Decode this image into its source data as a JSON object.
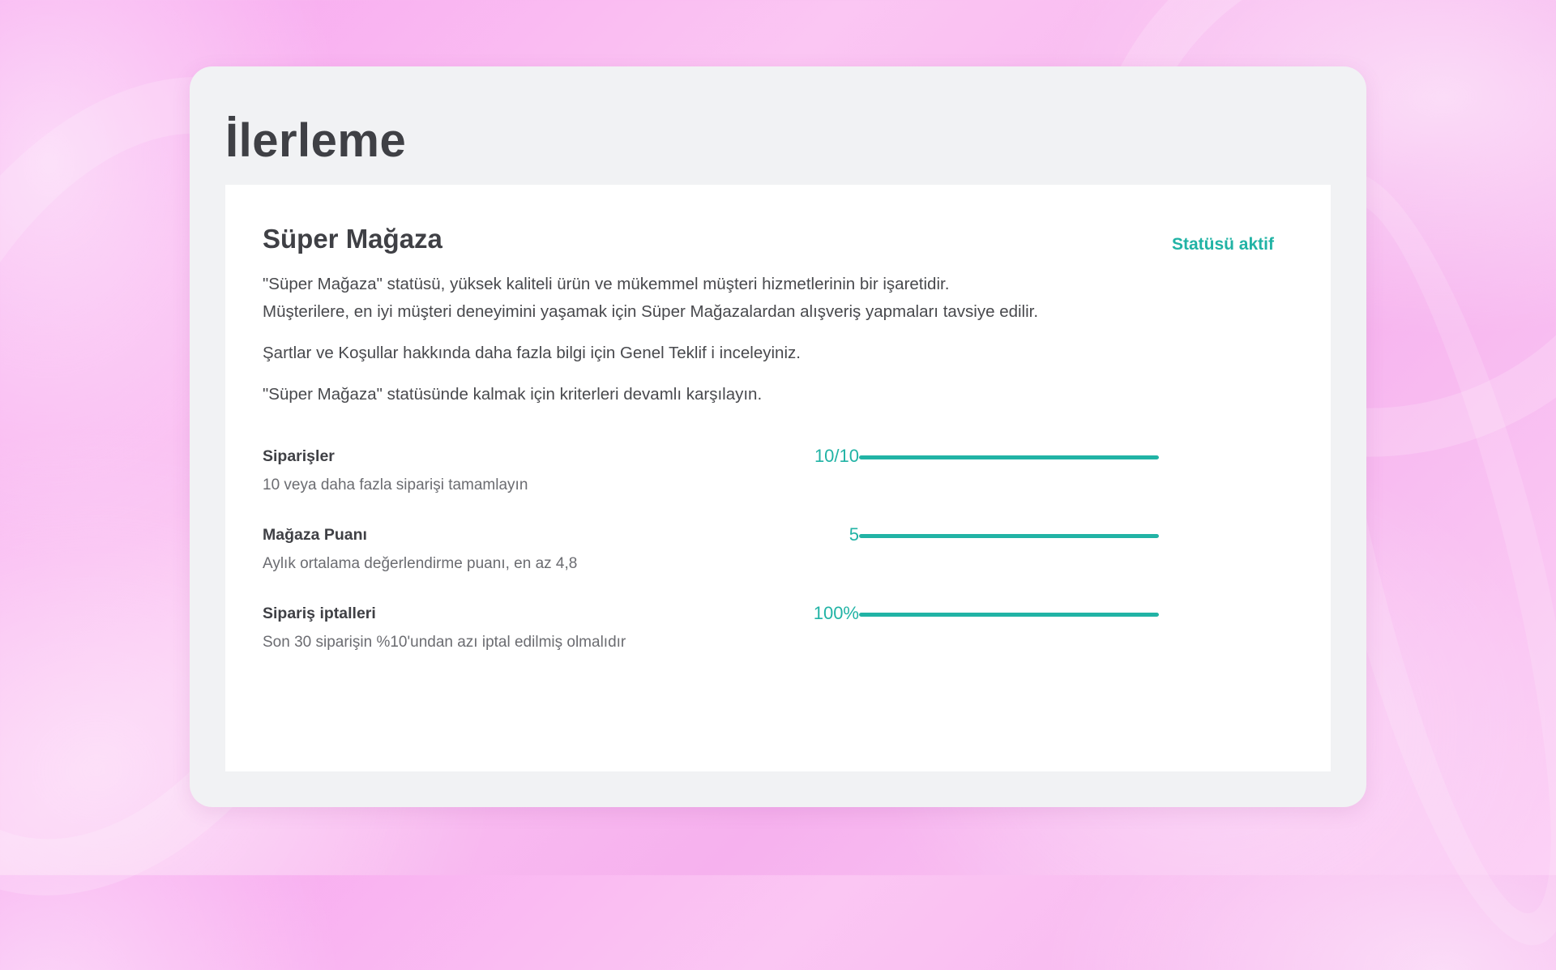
{
  "page": {
    "title": "İlerleme"
  },
  "program": {
    "title": "Süper Mağaza",
    "status": "Statüsü aktif",
    "description_lines": [
      "\"Süper Mağaza\" statüsü, yüksek kaliteli ürün ve mükemmel müşteri hizmetlerinin bir işaretidir.",
      "Müşterilere, en iyi müşteri deneyimini yaşamak için Süper Mağazalardan alışveriş yapmaları tavsiye edilir."
    ],
    "terms_text": "Şartlar ve Koşullar hakkında daha fazla bilgi için Genel Teklif i inceleyiniz.",
    "criteria_note": "\"Süper Mağaza\" statüsünde kalmak için kriterleri devamlı karşılayın."
  },
  "criteria": [
    {
      "title": "Siparişler",
      "subtitle": "10 veya daha fazla siparişi tamamlayın",
      "value": "10/10",
      "progress": 1.0
    },
    {
      "title": "Mağaza Puanı",
      "subtitle": "Aylık ortalama değerlendirme puanı, en az 4,8",
      "value": "5",
      "progress": 1.0
    },
    {
      "title": "Sipariş iptalleri",
      "subtitle": "Son 30 siparişin %10'undan azı iptal edilmiş olmalıdır",
      "value": "100%",
      "progress": 1.0
    }
  ],
  "colors": {
    "accent": "#21b3a5",
    "text_dark": "#3f4045",
    "panel_bg": "#f1f2f4"
  }
}
